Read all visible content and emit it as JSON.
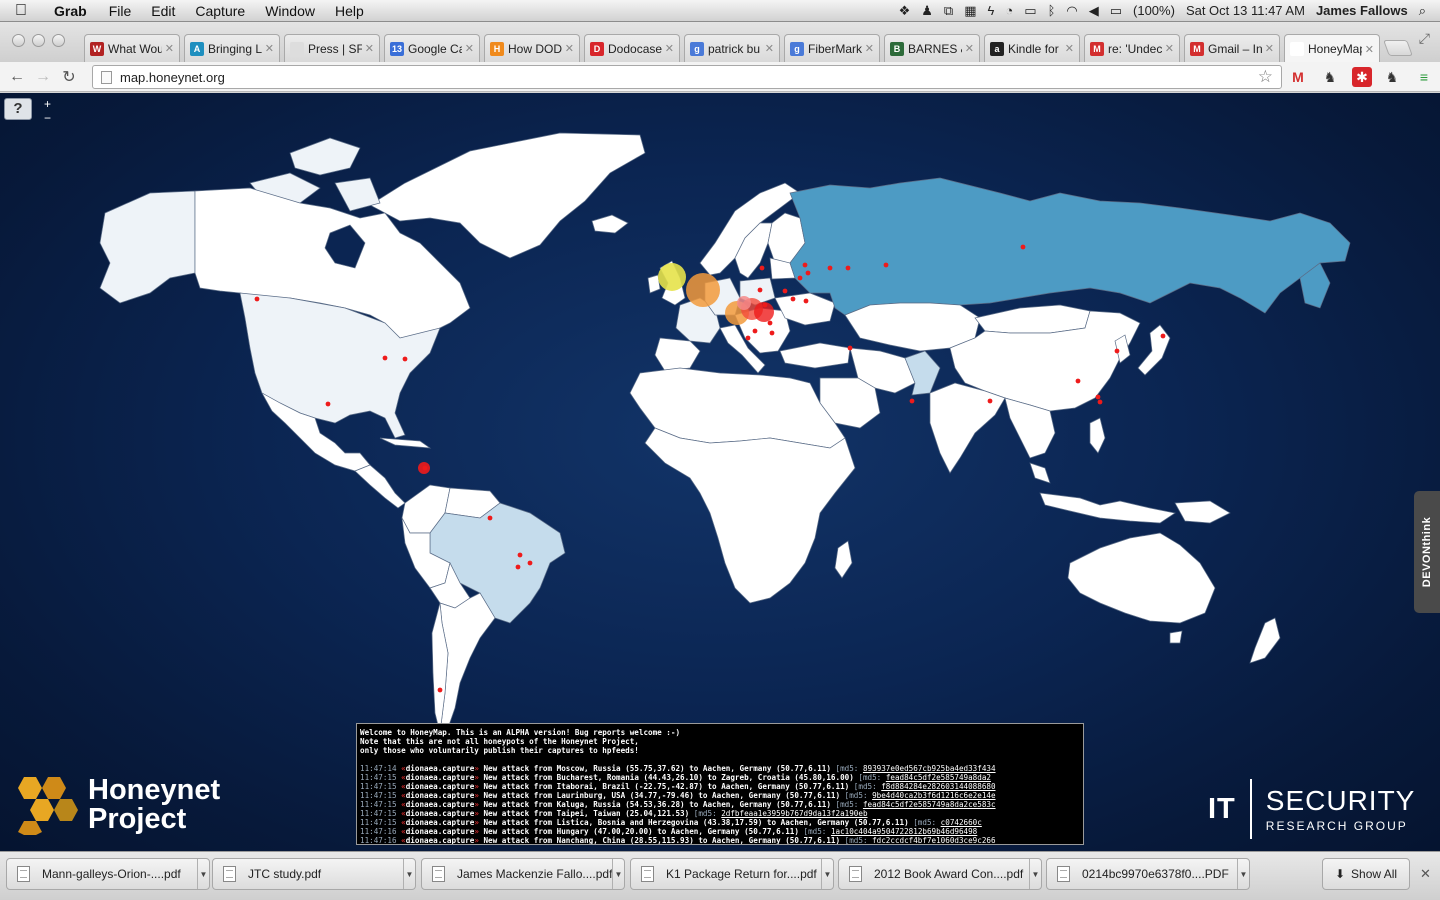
{
  "menubar": {
    "app_name": "Grab",
    "menus": [
      "File",
      "Edit",
      "Capture",
      "Window",
      "Help"
    ],
    "battery": "(100%)",
    "clock": "Sat Oct 13  11:47 AM",
    "user": "James Fallows"
  },
  "tabs": [
    {
      "label": "What Wou",
      "favicon": "W",
      "color": "#b22222"
    },
    {
      "label": "Bringing L",
      "favicon": "A",
      "color": "#1e8fbf"
    },
    {
      "label": "Press | SFI",
      "favicon": "",
      "color": "#dddddd"
    },
    {
      "label": "Google Ca",
      "favicon": "13",
      "color": "#3a6fd8"
    },
    {
      "label": "How DOD",
      "favicon": "H",
      "color": "#f08a1c"
    },
    {
      "label": "Dodocase",
      "favicon": "D",
      "color": "#d8262b"
    },
    {
      "label": "patrick bu",
      "favicon": "g",
      "color": "#4a7ad8"
    },
    {
      "label": "FiberMark",
      "favicon": "g",
      "color": "#4a7ad8"
    },
    {
      "label": "BARNES &",
      "favicon": "B",
      "color": "#2d6b3a"
    },
    {
      "label": "Kindle for",
      "favicon": "a",
      "color": "#222222"
    },
    {
      "label": "re: 'Undec",
      "favicon": "M",
      "color": "#d32f2f"
    },
    {
      "label": "Gmail – In",
      "favicon": "M",
      "color": "#d32f2f"
    },
    {
      "label": "HoneyMap",
      "favicon": "",
      "color": "#ffffff",
      "active": true
    }
  ],
  "toolbar": {
    "url": "map.honeynet.org"
  },
  "map": {
    "help_label": "?",
    "zoom_in": "+",
    "zoom_out": "−"
  },
  "console": {
    "intro": [
      "Welcome to HoneyMap. This is an ALPHA version! Bug reports welcome :-)",
      "Note that this are not all honeypots of the Honeynet Project,",
      "only those who voluntarily publish their captures to hpfeeds!"
    ],
    "entries": [
      {
        "time": "11:47:14",
        "source": "dionaea.capture",
        "text": "New attack from Moscow, Russia (55.75,37.62) to Aachen, Germany (50.77,6.11)",
        "md5": "893937e0ed567cb925ba4ed33f434"
      },
      {
        "time": "11:47:15",
        "source": "dionaea.capture",
        "text": "New attack from Bucharest, Romania (44.43,26.10) to Zagreb, Croatia (45.80,16.00)",
        "md5": "fead84c5df2e585749a8da2"
      },
      {
        "time": "11:47:15",
        "source": "dionaea.capture",
        "text": "New attack from Itaborai, Brazil (-22.75,-42.87) to Aachen, Germany (50.77,6.11)",
        "md5": "f8d884284e282603144088680"
      },
      {
        "time": "11:47:15",
        "source": "dionaea.capture",
        "text": "New attack from Laurinburg, USA (34.77,-79.46) to Aachen, Germany (50.77,6.11)",
        "md5": "9be4d40ca2b3f6d1216c6e2e14e"
      },
      {
        "time": "11:47:15",
        "source": "dionaea.capture",
        "text": "New attack from Kaluga, Russia (54.53,36.28) to Aachen, Germany (50.77,6.11)",
        "md5": "fead84c5df2e585749a8da2ce583c"
      },
      {
        "time": "11:47:15",
        "source": "dionaea.capture",
        "text": "New attack from Taipei, Taiwan (25.04,121.53)",
        "md5": "2dfbfeaa1e3959b767d9da13f2a190eb"
      },
      {
        "time": "11:47:15",
        "source": "dionaea.capture",
        "text": "New attack from Listica, Bosnia and Herzegovina (43.38,17.59) to Aachen, Germany (50.77,6.11)",
        "md5": "c0742660c"
      },
      {
        "time": "11:47:16",
        "source": "dionaea.capture",
        "text": "New attack from Hungary (47.00,20.00) to Aachen, Germany (50.77,6.11)",
        "md5": "1ac10c404a9504722812b69b46d96498"
      },
      {
        "time": "11:47:16",
        "source": "dionaea.capture",
        "text": "New attack from Nanchang, China (28.55,115.93) to Aachen, Germany (50.77,6.11)",
        "md5": "fdc2ccdcf4bf7e1060d3ce9c266"
      }
    ]
  },
  "logos": {
    "honeynet_line1": "Honeynet",
    "honeynet_line2": "Project",
    "it": "IT",
    "security": "SECURITY",
    "research": "RESEARCH GROUP"
  },
  "devon_label": "DEVONthink",
  "downloads": {
    "items": [
      "Mann-galleys-Orion-....pdf",
      "JTC study.pdf",
      "James Mackenzie Fallo....pdf",
      "K1 Package Return for....pdf",
      "2012 Book Award Con....pdf",
      "0214bc9970e6378f0....PDF"
    ],
    "show_all": "Show All"
  },
  "colors": {
    "map_background": "#0b2552",
    "russia_fill": "#4d9bc4",
    "highlight_fill": "#c5dcec",
    "light_fill": "#eef3f8",
    "land_fill": "#ffffff",
    "attack_dot": "#ee1b1b"
  }
}
